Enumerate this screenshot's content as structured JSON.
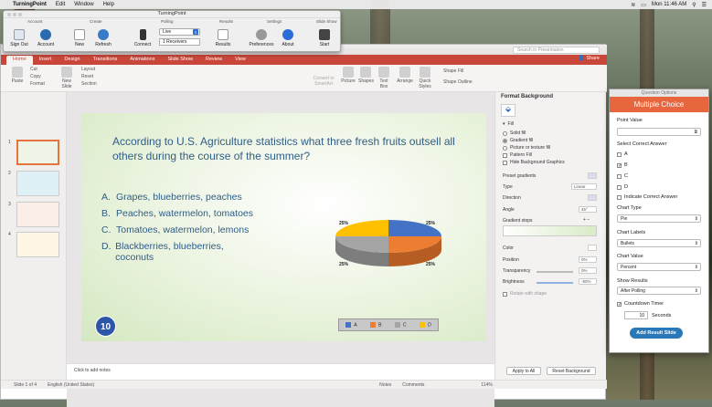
{
  "menubar": {
    "apple": "",
    "app": "TurningPoint",
    "items": [
      "Edit",
      "Window",
      "Help"
    ],
    "clock": "Mon 11:46 AM"
  },
  "turningpoint": {
    "title": "TurningPoint",
    "sections": [
      "Account",
      "Create",
      "Polling",
      "Results",
      "Settings",
      "Slide Show"
    ],
    "buttons": [
      "Sign Out",
      "Account",
      "New",
      "Refresh",
      "Connect",
      "Results",
      "Preferences",
      "About",
      "Start"
    ],
    "polling_mode": "Live",
    "receivers": "1   Receivers"
  },
  "ppt": {
    "search_placeholder": "Search in Presentation",
    "share": "Share",
    "tabs": [
      "Home",
      "Insert",
      "Design",
      "Transitions",
      "Animations",
      "Slide Show",
      "Review",
      "View"
    ],
    "ribbon": [
      "Paste",
      "Cut",
      "Copy",
      "Format",
      "New Slide",
      "Layout",
      "Reset",
      "Section",
      "Convert to SmartArt",
      "Picture",
      "Shapes",
      "Text Box",
      "Arrange",
      "Quick Styles",
      "Shape Fill",
      "Shape Outline"
    ],
    "slide_numbers": [
      "1",
      "2",
      "3",
      "4"
    ],
    "notes": "Click to add notes",
    "status": {
      "slide": "Slide 1 of 4",
      "language": "English (United States)",
      "notes": "Notes",
      "comments": "Comments",
      "zoom": "114%"
    }
  },
  "slide": {
    "question": "According to U.S. Agriculture statistics what three fresh fruits outsell all others during the course of the summer?",
    "answers": [
      {
        "letter": "A.",
        "text": "Grapes, blueberries, peaches"
      },
      {
        "letter": "B.",
        "text": "Peaches, watermelon, tomatoes"
      },
      {
        "letter": "C.",
        "text": "Tomatoes, watermelon, lemons"
      },
      {
        "letter": "D.",
        "text": "Blackberries, blueberries, coconuts"
      }
    ],
    "countdown": "10",
    "pie_labels": [
      "25%",
      "25%",
      "25%",
      "25%"
    ],
    "legend": [
      "A",
      "B",
      "C",
      "D"
    ],
    "colors": {
      "A": "#4472c4",
      "B": "#ed7d31",
      "C": "#a5a5a5",
      "D": "#ffc000"
    }
  },
  "format_pane": {
    "title": "Format Background",
    "fill": "Fill",
    "options": [
      "Solid fill",
      "Gradient fill",
      "Picture or texture fill",
      "Pattern Fill"
    ],
    "hide_graphics": "Hide Background Graphics",
    "preset": "Preset gradients",
    "type_label": "Type",
    "type_value": "Linear",
    "direction": "Direction",
    "angle_label": "Angle",
    "angle_value": "45°",
    "stops": "Gradient stops",
    "color": "Color",
    "position_label": "Position",
    "position_value": "0%",
    "transparency_label": "Transparency",
    "transparency_value": "0%",
    "brightness_label": "Brightness",
    "brightness_value": "-90%",
    "rotate": "Rotate with shape",
    "apply_all": "Apply to All",
    "reset": "Reset Background"
  },
  "question_options": {
    "window_title": "Question Options",
    "header": "Multiple Choice",
    "point_value_label": "Point Value",
    "point_value": "1",
    "correct_label": "Select Correct Answer",
    "choices": [
      "A",
      "B",
      "C",
      "D"
    ],
    "indicate": "Indicate Correct Answer",
    "chart_type_label": "Chart Type",
    "chart_type": "Pie",
    "chart_labels_label": "Chart Labels",
    "chart_labels": "Bullets",
    "chart_value_label": "Chart Value",
    "chart_value": "Percent",
    "show_results_label": "Show Results",
    "show_results": "After Polling",
    "countdown_label": "Countdown Timer",
    "seconds_value": "10",
    "seconds_label": "Seconds",
    "add_button": "Add Result Slide"
  }
}
